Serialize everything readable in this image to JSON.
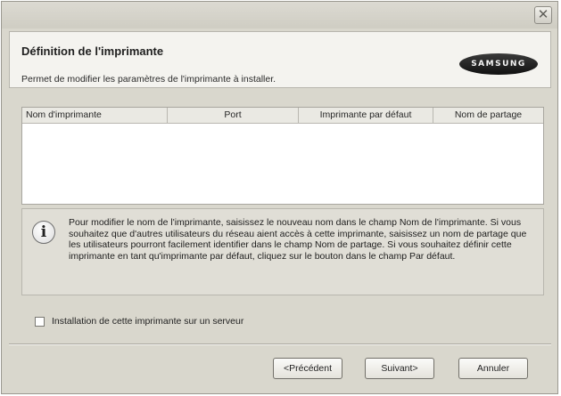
{
  "window": {
    "close_glyph": "✕"
  },
  "header": {
    "title": "Définition de l'imprimante",
    "subtitle": "Permet de modifier les paramètres de l'imprimante à installer.",
    "logo_text": "SAMSUNG"
  },
  "table": {
    "columns": [
      "Nom d'imprimante",
      "Port",
      "Imprimante par défaut",
      "Nom de partage"
    ],
    "rows": []
  },
  "info": {
    "icon": "info-icon",
    "text": "Pour modifier le nom de l'imprimante, saisissez le nouveau nom dans le champ Nom de l'imprimante. Si vous souhaitez que d'autres utilisateurs du réseau aient accès à cette imprimante, saisissez un nom de partage que les utilisateurs pourront facilement identifier dans le champ Nom de partage. Si vous souhaitez définir cette imprimante en tant qu'imprimante par défaut, cliquez sur le bouton dans le champ Par défaut."
  },
  "options": {
    "server_install_label": "Installation de cette imprimante sur un serveur",
    "server_install_checked": false
  },
  "buttons": {
    "back": "<Précédent",
    "next": "Suivant>",
    "cancel": "Annuler"
  }
}
